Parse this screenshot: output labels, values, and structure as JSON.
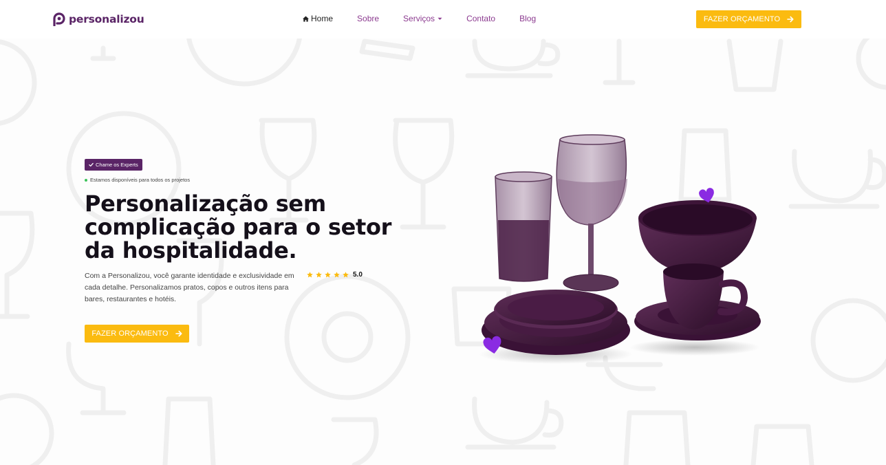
{
  "header": {
    "logo_text": "personalizou",
    "nav": [
      {
        "label": "Home",
        "active": true
      },
      {
        "label": "Sobre"
      },
      {
        "label": "Serviços",
        "has_dropdown": true
      },
      {
        "label": "Contato"
      },
      {
        "label": "Blog"
      }
    ],
    "cta_label": "FAZER ORÇAMENTO"
  },
  "hero": {
    "badge": "Chame os Experts",
    "availability": "Estamos disponíveis para todos os projetos",
    "headline": "Personalização sem complicação para o setor da hospitalidade.",
    "description": "Com a Personalizou, você garante identidade e exclusividade em cada detalhe. Personalizamos pratos, copos e outros itens para bares, restaurantes e hotéis.",
    "rating": {
      "stars": 5,
      "value": "5.0"
    },
    "cta_label": "FAZER ORÇAMENTO"
  },
  "colors": {
    "brand_purple": "#5a2466",
    "nav_purple": "#8b3a8f",
    "accent_yellow": "#fbbb10",
    "heart_purple": "#8a2be2",
    "status_green": "#3dc35a"
  },
  "icons": [
    "home-icon",
    "chevron-down-icon",
    "arrow-right-icon",
    "check-icon",
    "star-icon",
    "heart-icon"
  ]
}
